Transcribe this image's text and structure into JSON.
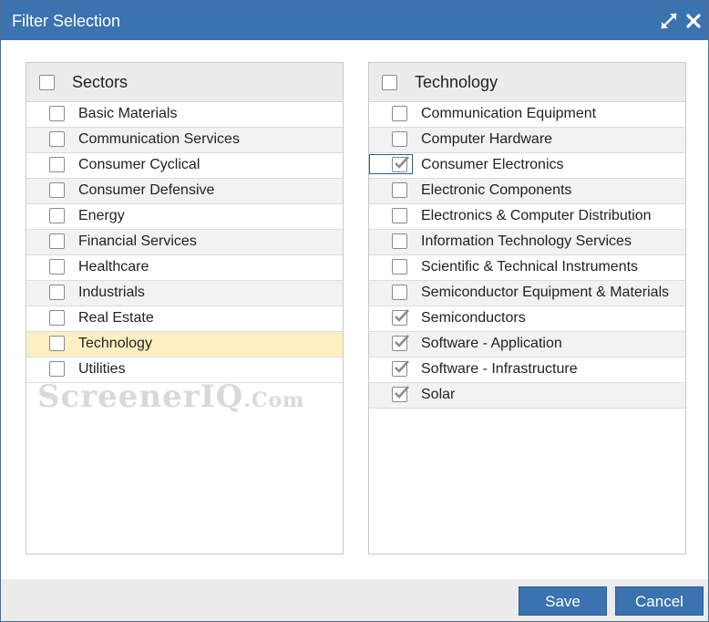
{
  "dialog": {
    "title": "Filter Selection",
    "expand_icon": "expand-arrows-icon",
    "close_icon": "close-x-icon"
  },
  "sectors": {
    "header": "Sectors",
    "items": [
      {
        "label": "Basic Materials",
        "checked": false
      },
      {
        "label": "Communication Services",
        "checked": false
      },
      {
        "label": "Consumer Cyclical",
        "checked": false
      },
      {
        "label": "Consumer Defensive",
        "checked": false
      },
      {
        "label": "Energy",
        "checked": false
      },
      {
        "label": "Financial Services",
        "checked": false
      },
      {
        "label": "Healthcare",
        "checked": false
      },
      {
        "label": "Industrials",
        "checked": false
      },
      {
        "label": "Real Estate",
        "checked": false
      },
      {
        "label": "Technology",
        "checked": false,
        "selected": true
      },
      {
        "label": "Utilities",
        "checked": false
      }
    ]
  },
  "watermark": {
    "main": "ScreenerIQ",
    "suffix": ".Com"
  },
  "technology": {
    "header": "Technology",
    "items": [
      {
        "label": "Communication Equipment",
        "checked": false
      },
      {
        "label": "Computer Hardware",
        "checked": false
      },
      {
        "label": "Consumer Electronics",
        "checked": true,
        "focused": true
      },
      {
        "label": "Electronic Components",
        "checked": false
      },
      {
        "label": "Electronics & Computer Distribution",
        "checked": false
      },
      {
        "label": "Information Technology Services",
        "checked": false
      },
      {
        "label": "Scientific & Technical Instruments",
        "checked": false
      },
      {
        "label": "Semiconductor Equipment & Materials",
        "checked": false
      },
      {
        "label": "Semiconductors",
        "checked": true
      },
      {
        "label": "Software - Application",
        "checked": true
      },
      {
        "label": "Software - Infrastructure",
        "checked": true
      },
      {
        "label": "Solar",
        "checked": true
      }
    ]
  },
  "footer": {
    "save_label": "Save",
    "cancel_label": "Cancel"
  },
  "colors": {
    "titlebar": "#3a73b0",
    "highlight_row": "#fcf0c2",
    "button": "#3a73b0"
  }
}
